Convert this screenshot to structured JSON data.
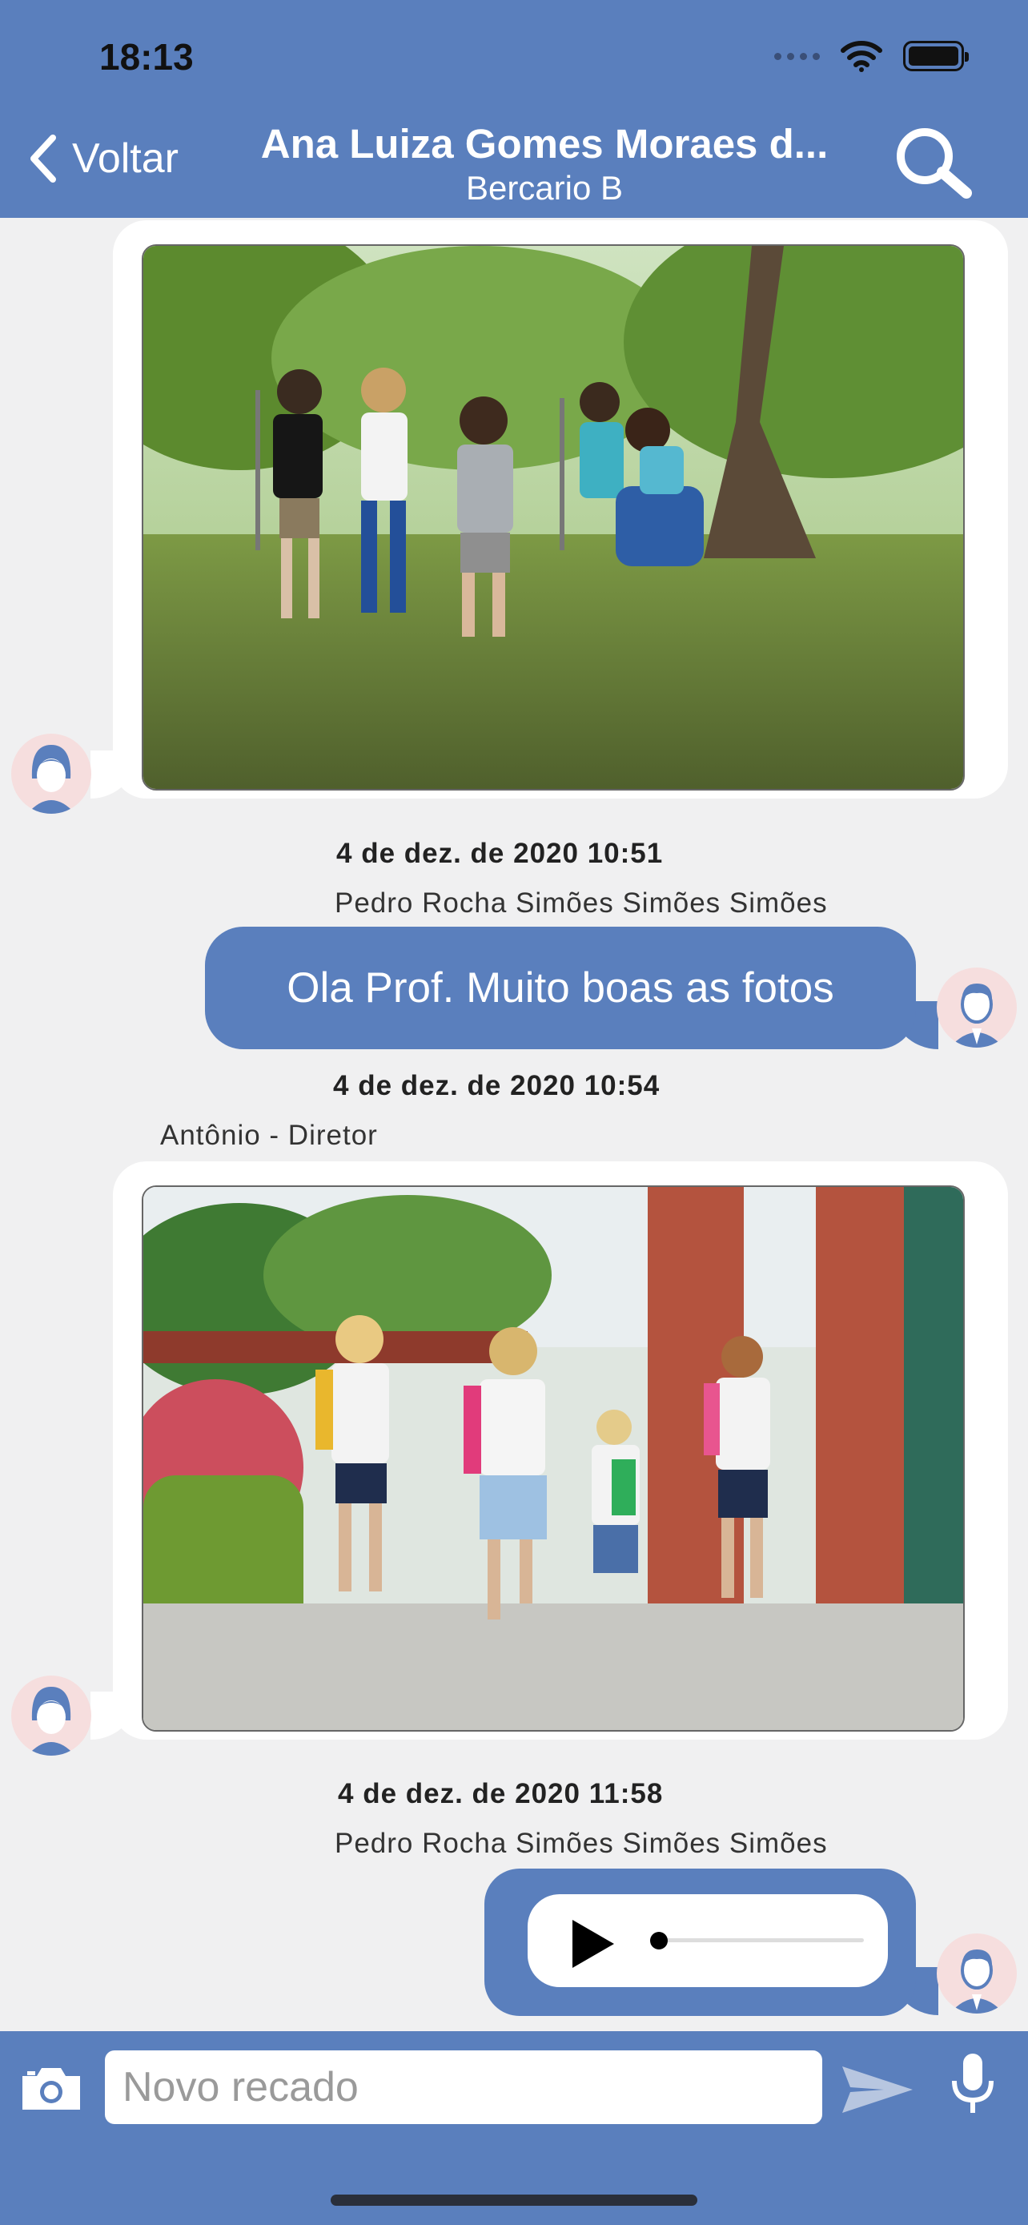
{
  "status_bar": {
    "time": "18:13"
  },
  "header": {
    "back_label": "Voltar",
    "title": "Ana Luiza Gomes Moraes d...",
    "subtitle": "Bercario B"
  },
  "messages": [
    {
      "type": "image",
      "direction": "incoming",
      "photo_alt": "Crianças brincando de roda no parque"
    },
    {
      "type": "text",
      "direction": "outgoing",
      "timestamp": "4 de dez. de 2020 10:51",
      "sender": "Pedro Rocha Simões Simões Simões",
      "text": "Ola Prof. Muito boas as fotos"
    },
    {
      "type": "image",
      "direction": "incoming",
      "timestamp": "4 de dez. de 2020 10:54",
      "sender": "Antônio - Diretor",
      "photo_alt": "Crianças de máscara correndo na escola"
    },
    {
      "type": "audio",
      "direction": "outgoing",
      "timestamp": "4 de dez. de 2020 11:58",
      "sender": "Pedro Rocha Simões Simões Simões",
      "progress": 0
    }
  ],
  "composer": {
    "placeholder": "Novo recado"
  },
  "colors": {
    "brand": "#5a7fbd",
    "background": "#f0f0f1",
    "avatar_bg": "#f6dede"
  }
}
